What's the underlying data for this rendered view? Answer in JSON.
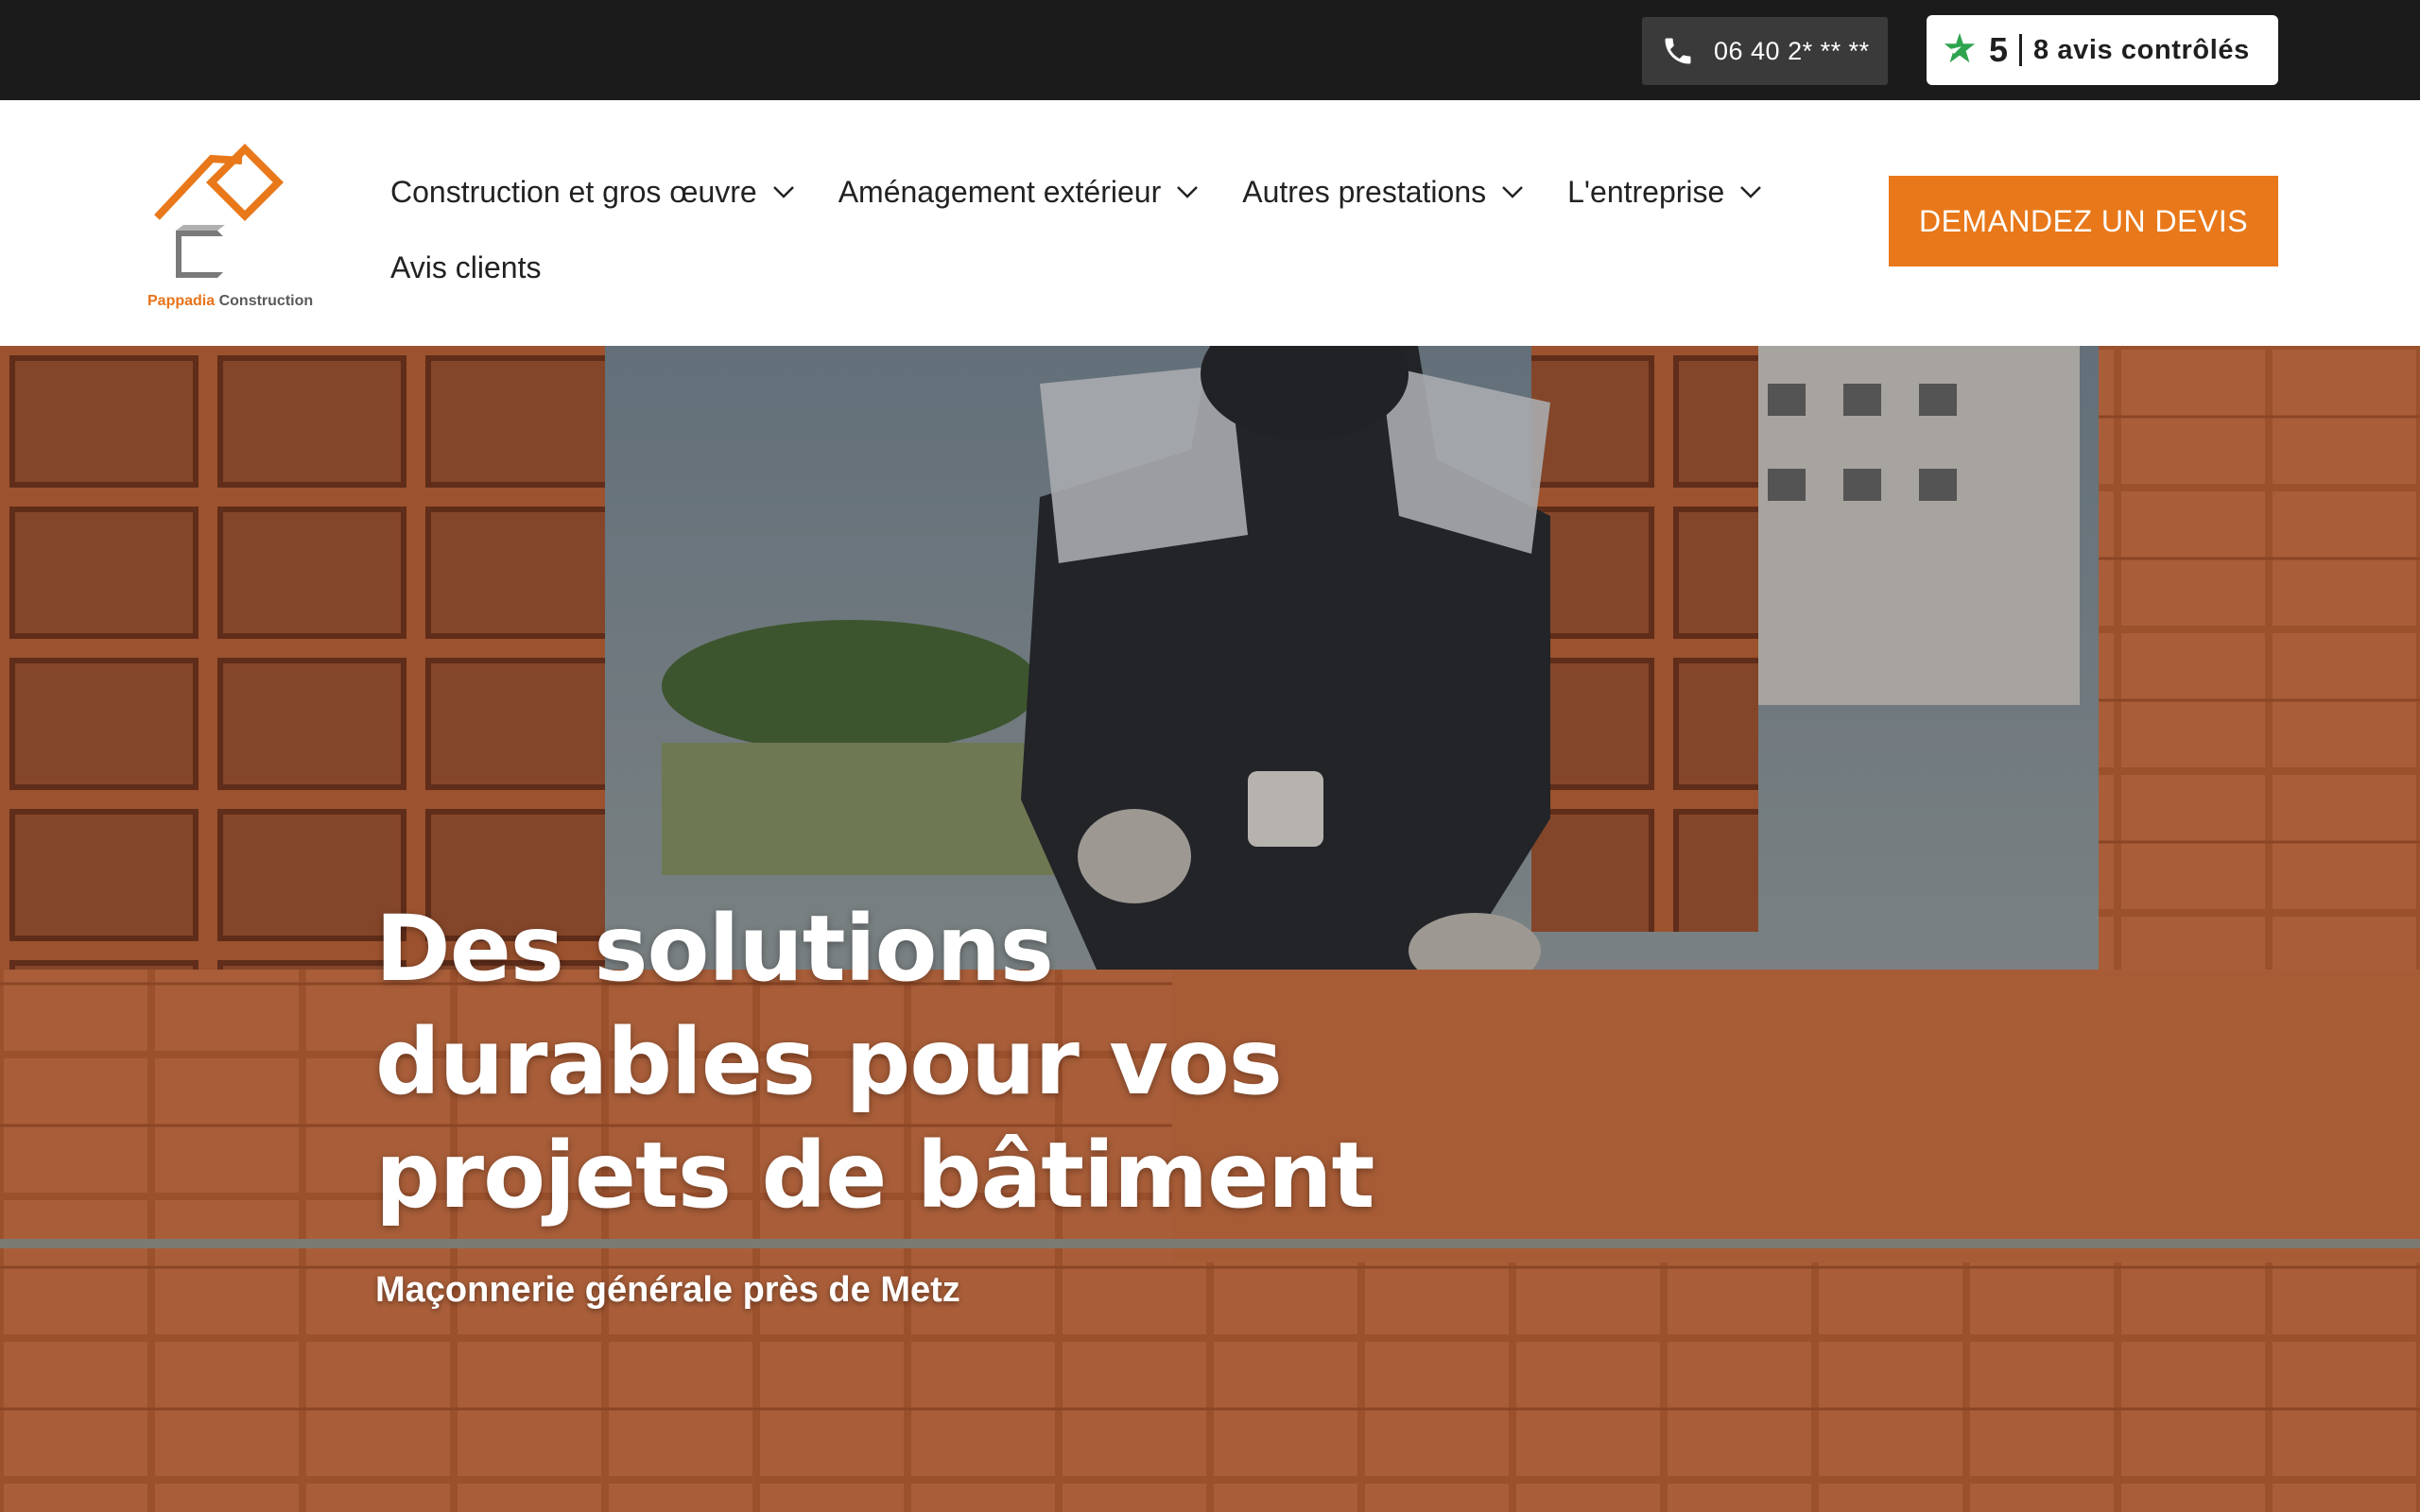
{
  "topbar": {
    "phone": "06 40 2* ** **",
    "review_score": "5",
    "review_text": "8 avis contrôlés"
  },
  "logo": {
    "brand_part1": "Pappadia",
    "brand_part2": "Construction"
  },
  "nav": {
    "items": [
      {
        "label": "Construction et gros œuvre",
        "has_dropdown": true
      },
      {
        "label": "Aménagement extérieur",
        "has_dropdown": true
      },
      {
        "label": "Autres prestations",
        "has_dropdown": true
      },
      {
        "label": "L'entreprise",
        "has_dropdown": true
      },
      {
        "label": "Avis clients",
        "has_dropdown": false
      }
    ]
  },
  "cta": {
    "label": "DEMANDEZ UN DEVIS"
  },
  "hero": {
    "title_line1": "Des solutions",
    "title_line2": "durables pour vos",
    "title_line3": "projets de bâtiment",
    "subtitle": "Maçonnerie générale près de Metz"
  },
  "colors": {
    "accent": "#e8781a",
    "topbar": "#1b1b1b",
    "review_green": "#2ea44f"
  }
}
